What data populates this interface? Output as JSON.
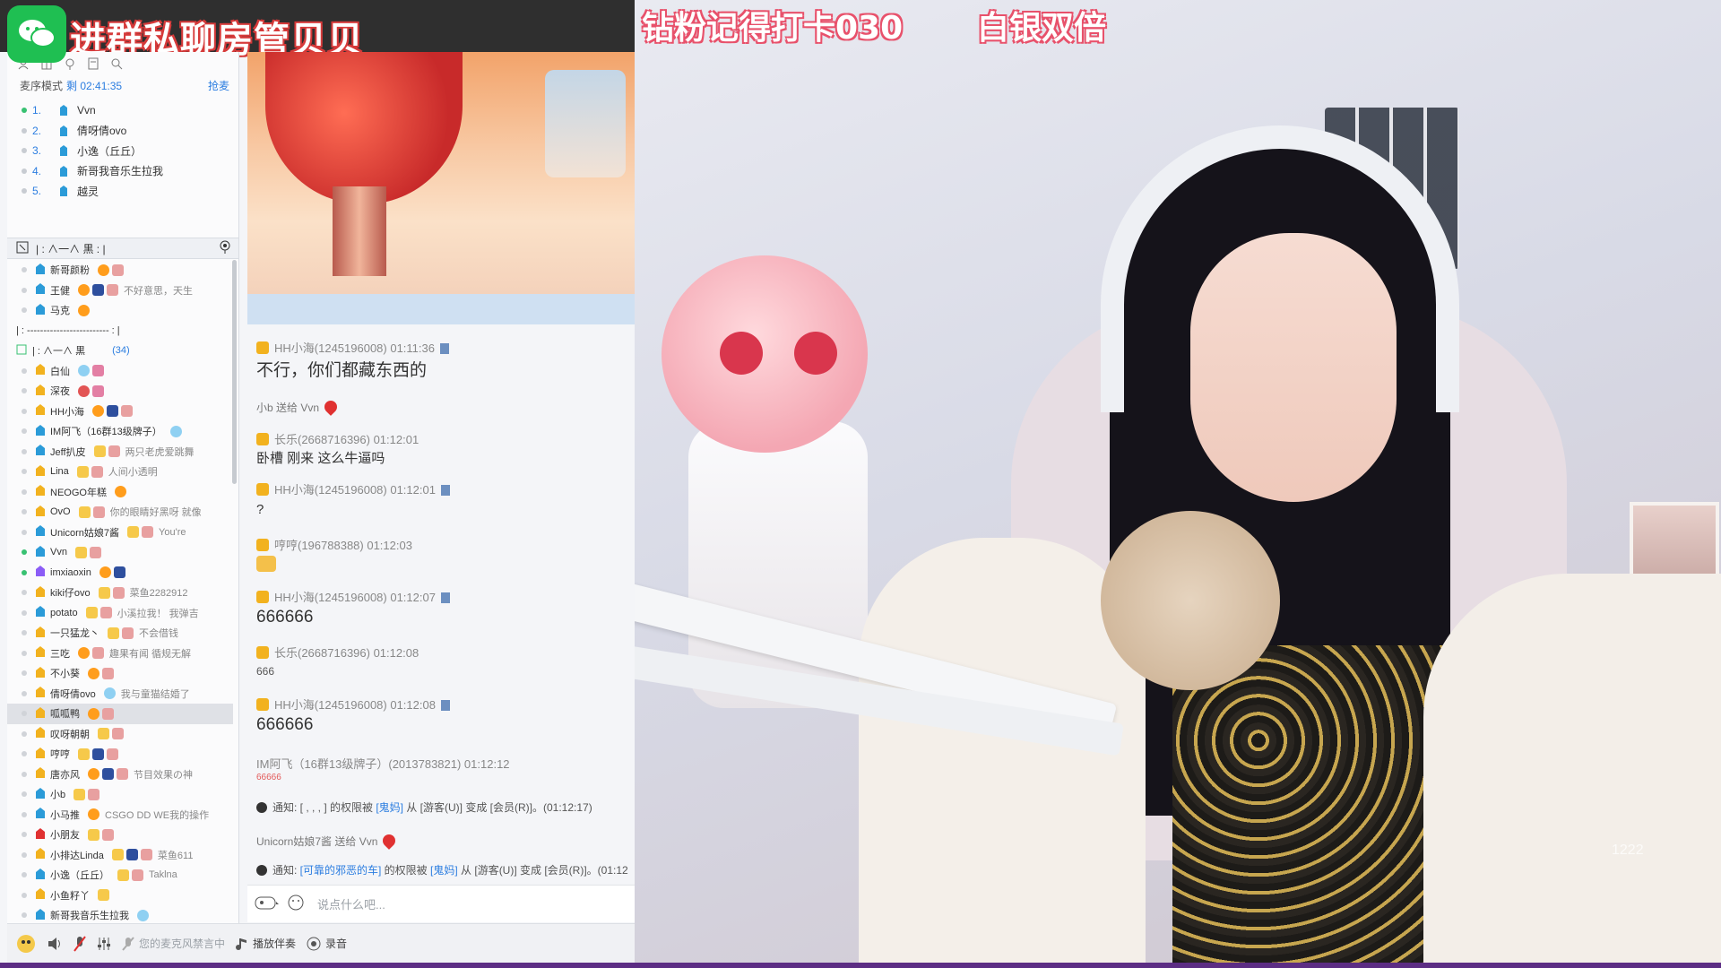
{
  "banner": {
    "text": "进群私聊房管贝贝"
  },
  "stream_overlay": {
    "left": "钻粉记得打卡030",
    "right": "白银双倍"
  },
  "sidebar": {
    "mic_mode": {
      "label": "麦序模式",
      "time": "剩 02:41:35",
      "grab": "抢麦"
    },
    "queue": [
      {
        "num": "1.",
        "name": "Vvn",
        "active": true
      },
      {
        "num": "2.",
        "name": "倩呀倩ovo",
        "active": false
      },
      {
        "num": "3.",
        "name": "小逸（丘丘）",
        "active": false
      },
      {
        "num": "4.",
        "name": "新哥我音乐生拉我",
        "active": false
      },
      {
        "num": "5.",
        "name": "越灵",
        "active": false
      }
    ],
    "channel_bar": "| : ∧一∧ 黒 : |",
    "sub_channel_1": "| :  -------------------------  : |",
    "sub_channel_2": {
      "label": "| :        ∧一∧        黒",
      "count": "(34)"
    },
    "members_top": [
      {
        "name": "新哥颜粉",
        "sig": ""
      },
      {
        "name": "王健",
        "sig": "不好意思，天生"
      },
      {
        "name": "马克",
        "sig": ""
      }
    ],
    "members": [
      {
        "name": "白仙",
        "sig": ""
      },
      {
        "name": "深夜",
        "sig": ""
      },
      {
        "name": "HH小海",
        "sig": ""
      },
      {
        "name": "IM阿飞（16群13级牌子）",
        "sig": ""
      },
      {
        "name": "Jeff扒皮",
        "sig": "两只老虎爱跳舞"
      },
      {
        "name": "Lina",
        "sig": "人间小透明"
      },
      {
        "name": "NEOGO年糕",
        "sig": ""
      },
      {
        "name": "OvO",
        "sig": "你的眼睛好黑呀 就像"
      },
      {
        "name": "Unicorn姑娘7酱",
        "sig": "You're"
      },
      {
        "name": "Vvn",
        "sig": ""
      },
      {
        "name": "imxiaoxin",
        "sig": ""
      },
      {
        "name": "kiki仔ovo",
        "sig": "菜鱼2282912"
      },
      {
        "name": "potato",
        "sig": "小溪拉我！ 我弹吉"
      },
      {
        "name": "一只猛龙丶",
        "sig": "不会借钱"
      },
      {
        "name": "三吃",
        "sig": "趣果有闻 循规无解"
      },
      {
        "name": "不小葵",
        "sig": ""
      },
      {
        "name": "倩呀倩ovo",
        "sig": "我与童猫结婚了"
      },
      {
        "name": "呱呱鸭",
        "sig": ""
      },
      {
        "name": "叹呀朝朝",
        "sig": ""
      },
      {
        "name": "哼哼",
        "sig": ""
      },
      {
        "name": "唐亦风",
        "sig": "节目效果の神"
      },
      {
        "name": "小b",
        "sig": ""
      },
      {
        "name": "小马推",
        "sig": "CSGO DD WE我的操作"
      },
      {
        "name": "小朋友",
        "sig": ""
      },
      {
        "name": "小排达Linda",
        "sig": "菜鱼611"
      },
      {
        "name": "小逸（丘丘）",
        "sig": "Taklna"
      },
      {
        "name": "小鱼籽丫",
        "sig": ""
      },
      {
        "name": "新哥我音乐生拉我",
        "sig": ""
      }
    ]
  },
  "chat": {
    "messages": [
      {
        "header": "HH小海(1245196008)  01:11:36",
        "body": "不行，你们都藏东西的"
      },
      {
        "gift": "小b 送给 Vvn"
      },
      {
        "header": "长乐(2668716396)  01:12:01",
        "body": "卧槽 刚来 这么牛逼吗"
      },
      {
        "header": "HH小海(1245196008)  01:12:01",
        "body": "?"
      },
      {
        "header": "哼哼(196788388)  01:12:03",
        "body": ""
      },
      {
        "header": "HH小海(1245196008)  01:12:07",
        "body": "666666"
      },
      {
        "header": "长乐(2668716396)  01:12:08",
        "body": "666"
      },
      {
        "header": "HH小海(1245196008)  01:12:08",
        "body": "666666"
      },
      {
        "header": "IM阿飞（16群13级牌子）(2013783821)  01:12:12",
        "body": "66666"
      },
      {
        "notice_prefix": "通知: [ , , , ] 的权限被 ",
        "notice_link": "[鬼妈]",
        "notice_suffix": " 从 [游客(U)] 变成 [会员(R)]。(01:12:17)"
      },
      {
        "gift": "Unicorn姑娘7酱 送给 Vvn"
      },
      {
        "notice_prefix": "通知: ",
        "notice_link": "[可靠的邪恶的车]",
        "notice_mid": " 的权限被 ",
        "notice_link2": "[鬼妈]",
        "notice_suffix": " 从 [游客(U)] 变成 [会员(R)]。(01:12"
      }
    ],
    "input_placeholder": "说点什么吧..."
  },
  "bottom_bar": {
    "mic_status": "您的麦克风禁言中",
    "accompany": "播放伴奏",
    "record": "录音"
  },
  "watermark": "1222",
  "colors": {
    "accent": "#2b7de0",
    "online": "#38c172",
    "brand_strip": "#5c2d84",
    "overlay_stroke": "#e8516b",
    "banner_stroke": "#d63a3a"
  }
}
